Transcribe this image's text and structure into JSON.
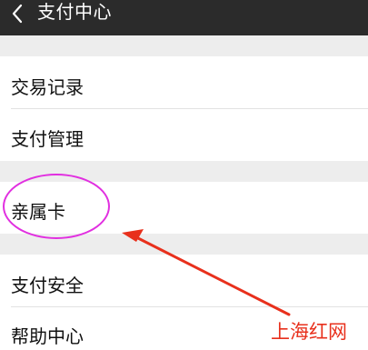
{
  "header": {
    "title": "支付中心",
    "back_icon": "chevron-left-icon",
    "background": "#2b2b2b"
  },
  "menu": {
    "items": [
      {
        "label": "交易记录"
      },
      {
        "label": "支付管理"
      },
      {
        "label": "亲属卡"
      },
      {
        "label": "支付安全"
      },
      {
        "label": "帮助中心"
      }
    ]
  },
  "annotation": {
    "highlight_color": "#e12fe0",
    "arrow_color": "#e8301c",
    "watermark": "上海红网"
  }
}
